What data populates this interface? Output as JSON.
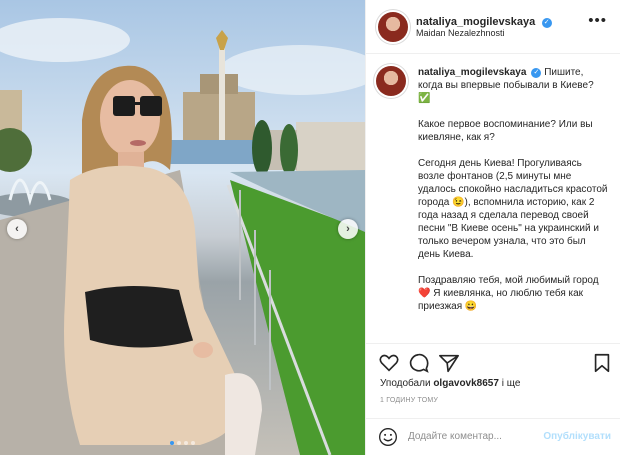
{
  "post": {
    "username": "nataliya_mogilevskaya",
    "location": "Maidan Nezalezhnosti",
    "more_glyph": "•••",
    "caption_paragraphs": [
      "Пишите, когда вы впервые побывали в Киеве? ✅",
      "Какое первое воспоминание? Или вы киевляне, как я?",
      "Сегодня день Киева! Прогуливаясь возле фонтанов (2,5 минуты мне удалось спокойно насладиться красотой города 😉), вспомнила историю, как 2 года назад я сделала перевод своей песни \"В Киеве осень\" на украинский и только вечером узнала, что это был день Киева.",
      "Поздравляю тебя, мой любимый город ❤️ Я киевлянка, но люблю тебя как приезжая 😀"
    ],
    "likes_prefix": "Уподобали",
    "likes_user": "olgavovk8657",
    "likes_suffix": "і ще",
    "timestamp": "1 ГОДИНУ ТОМУ",
    "comment_placeholder": "Додайте коментар...",
    "publish_label": "Опублікувати",
    "carousel": {
      "count": 4,
      "active_index": 0
    }
  },
  "icons": {
    "verified": "verified-badge-icon",
    "like": "heart-icon",
    "comment": "comment-icon",
    "share": "paper-plane-icon",
    "save": "bookmark-icon",
    "emoji": "smiley-icon",
    "prev": "chevron-left-icon",
    "next": "chevron-right-icon"
  },
  "colors": {
    "verified": "#3897f0",
    "link_disabled": "#b2dffc",
    "muted": "#8e8e8e",
    "text": "#262626"
  }
}
